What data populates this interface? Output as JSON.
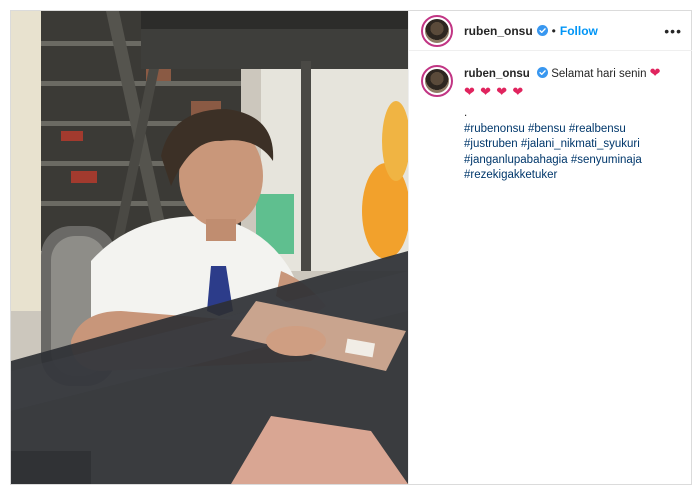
{
  "post": {
    "username": "ruben_onsu",
    "follow_label": "Follow",
    "separator": "•",
    "more_label": "•••",
    "caption": {
      "username": "ruben_onsu",
      "text": "Selamat hari senin",
      "line2_period": ".",
      "hashtags": [
        "#rubenonsu",
        "#bensu",
        "#realbensu",
        "#justruben",
        "#jalani_nikmati_syukuri",
        "#janganlupabahagia",
        "#senyuminaja",
        "#rezekigakketuker"
      ]
    }
  },
  "colors": {
    "follow": "#0095f6",
    "hashtag": "#00376b",
    "heart": "#e0245e",
    "verified": "#3897f0"
  },
  "icons": {
    "verified": "verified-badge-icon",
    "heart": "heart-emoji-icon",
    "more": "more-options-icon"
  }
}
